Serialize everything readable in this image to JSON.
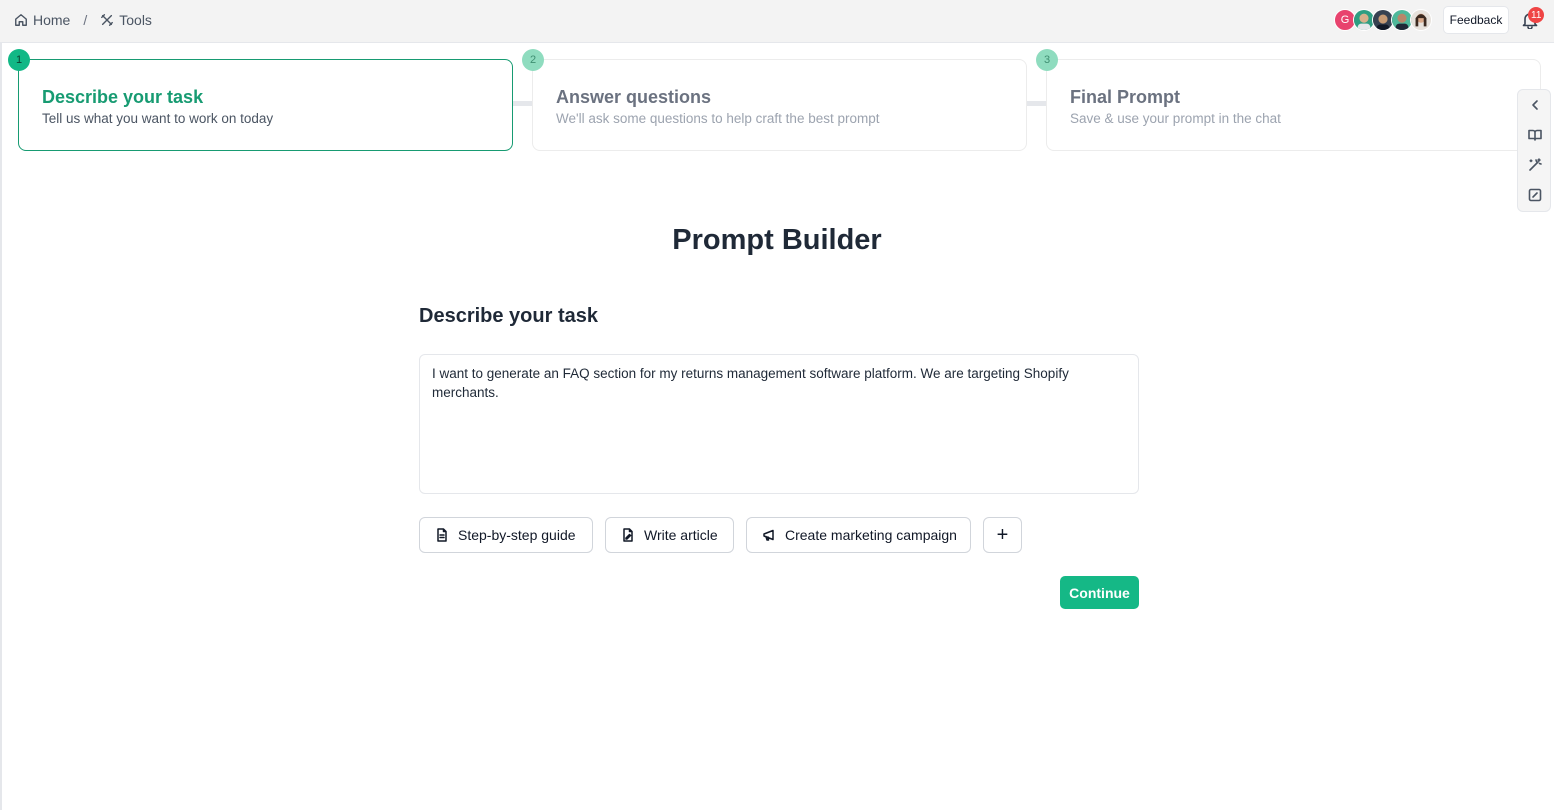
{
  "breadcrumb": {
    "home": "Home",
    "separator": "/",
    "tools": "Tools"
  },
  "header": {
    "avatar_initial": "G",
    "feedback_label": "Feedback",
    "notification_count": "11"
  },
  "steps": [
    {
      "number": "1",
      "title": "Describe your task",
      "subtitle": "Tell us what you want to work on today"
    },
    {
      "number": "2",
      "title": "Answer questions",
      "subtitle": "We'll ask some questions to help craft the best prompt"
    },
    {
      "number": "3",
      "title": "Final Prompt",
      "subtitle": "Save & use your prompt in the chat"
    }
  ],
  "main": {
    "title": "Prompt Builder",
    "section_title": "Describe your task",
    "task_value": "I want to generate an FAQ section for my returns management software platform. We are targeting Shopify merchants.",
    "chips": {
      "step_guide": "Step-by-step guide",
      "write_article": "Write article",
      "marketing": "Create marketing campaign",
      "add": "+"
    },
    "continue_label": "Continue"
  },
  "colors": {
    "accent": "#15b886",
    "accent_dark": "#179b72",
    "notification": "#ef4444"
  }
}
